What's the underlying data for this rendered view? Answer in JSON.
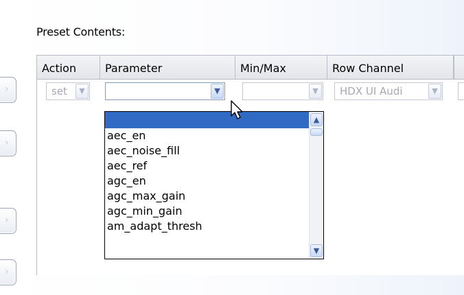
{
  "section_title": "Preset Contents:",
  "columns": [
    "Action",
    "Parameter",
    "Min/Max",
    "Row Channel",
    ""
  ],
  "row": {
    "action": "set",
    "parameter": "",
    "minmax": "",
    "row_channel": "HDX UI Audi"
  },
  "dropdown": {
    "selected": "",
    "items": [
      "aec_en",
      "aec_noise_fill",
      "aec_ref",
      "agc_en",
      "agc_max_gain",
      "agc_min_gain",
      "am_adapt_thresh"
    ]
  },
  "icons": {
    "combo_button": "chevron-down-icon",
    "scroll_up": "chevron-up-icon",
    "scroll_down": "chevron-down-icon",
    "cursor": "mouse-pointer-icon"
  },
  "colors": {
    "selection": "#316ac5",
    "combo_border": "#7f9db9"
  }
}
